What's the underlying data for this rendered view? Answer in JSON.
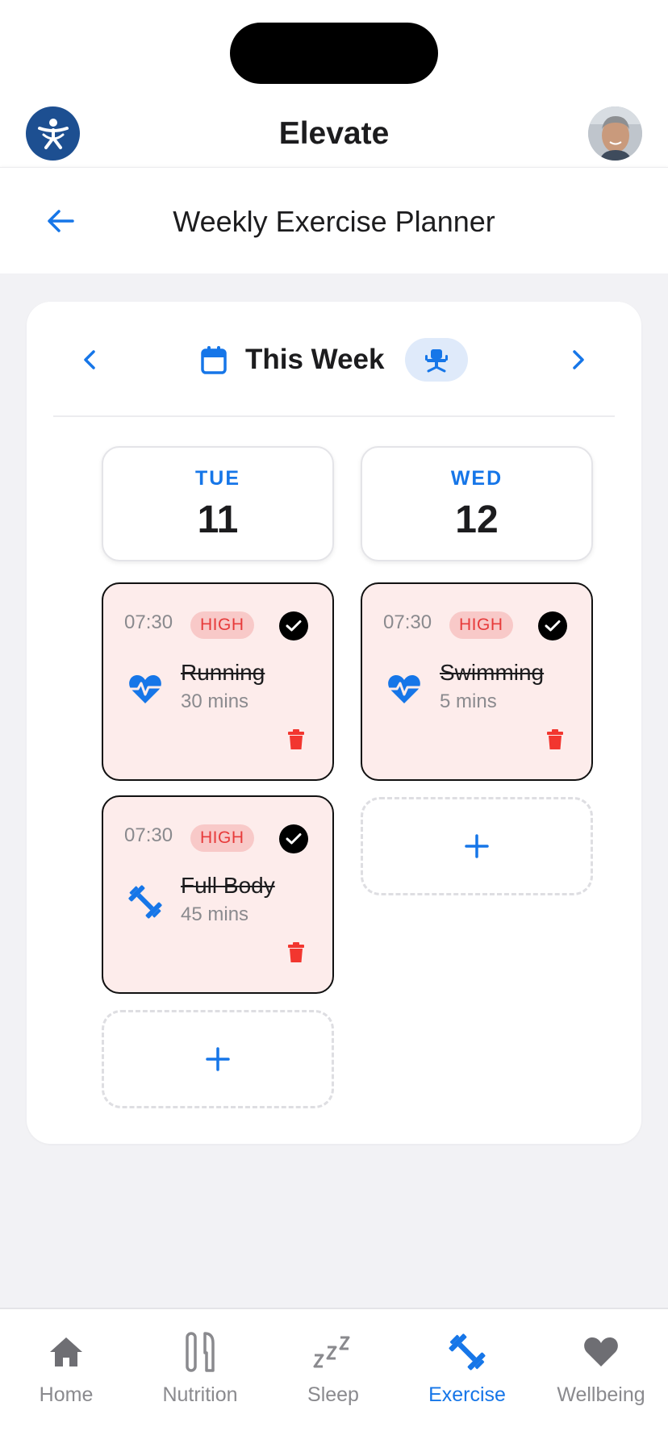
{
  "app": {
    "title": "Elevate"
  },
  "header": {
    "page_title": "Weekly Exercise Planner"
  },
  "week": {
    "label": "This Week"
  },
  "days": [
    {
      "name": "TUE",
      "number": "11"
    },
    {
      "name": "WED",
      "number": "12"
    }
  ],
  "exercises": {
    "tue": [
      {
        "time": "07:30",
        "intensity": "HIGH",
        "name": "Running",
        "duration": "30 mins",
        "icon": "heart-pulse-icon",
        "completed": true
      },
      {
        "time": "07:30",
        "intensity": "HIGH",
        "name": "Full Body",
        "duration": "45 mins",
        "icon": "dumbbell-icon",
        "completed": true
      }
    ],
    "wed": [
      {
        "time": "07:30",
        "intensity": "HIGH",
        "name": "Swimming",
        "duration": "5 mins",
        "icon": "heart-pulse-icon",
        "completed": true
      }
    ]
  },
  "add_label": "+",
  "nav": [
    {
      "label": "Home",
      "icon": "home-icon",
      "active": false
    },
    {
      "label": "Nutrition",
      "icon": "utensils-icon",
      "active": false
    },
    {
      "label": "Sleep",
      "icon": "sleep-zzz-icon",
      "active": false
    },
    {
      "label": "Exercise",
      "icon": "dumbbell-icon",
      "active": true
    },
    {
      "label": "Wellbeing",
      "icon": "heart-icon",
      "active": false
    }
  ],
  "colors": {
    "accent": "#1676e8",
    "high_badge_bg": "#f8c9c8",
    "high_badge_text": "#e73b3b",
    "card_bg": "#fdeceb",
    "delete": "#f2362f",
    "logo_bg": "#1d4f91"
  }
}
